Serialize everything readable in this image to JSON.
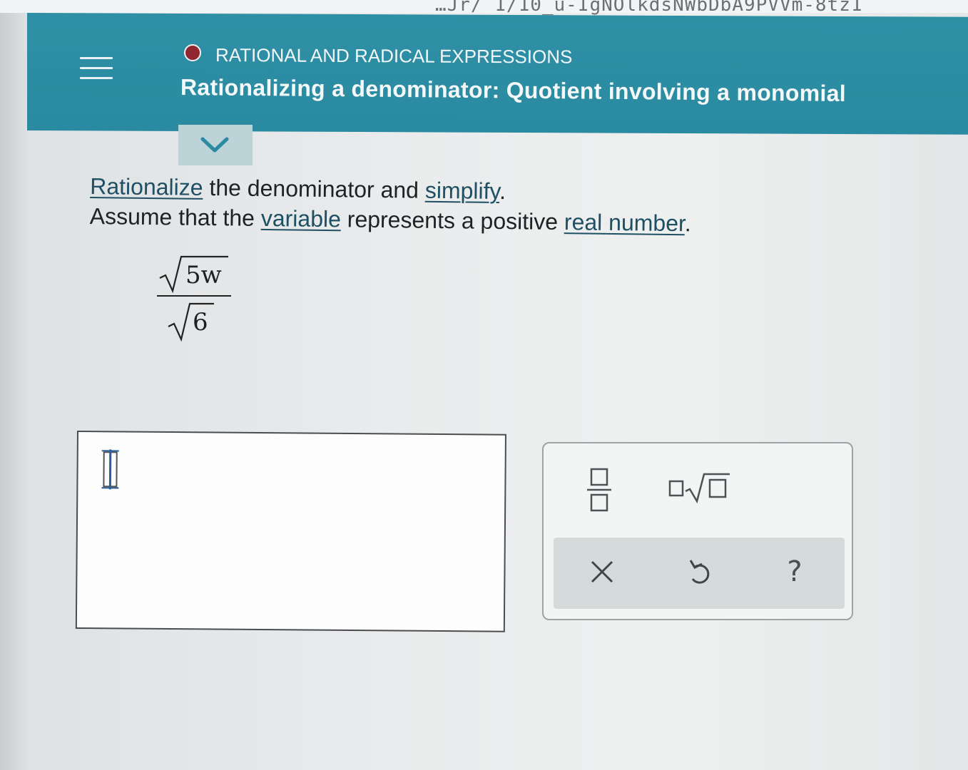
{
  "browser": {
    "url_fragment": "…Jr/ 1/10_u-IgNOlkdsNWbDbA9PVVm-8tz1"
  },
  "header": {
    "topic": "RATIONAL AND RADICAL EXPRESSIONS",
    "title": "Rationalizing a denominator: Quotient involving a monomial",
    "status_color": "#8f2630",
    "accent_color": "#2a8aa1"
  },
  "problem": {
    "link_rationalize": "Rationalize",
    "text_1": " the denominator and ",
    "link_simplify": "simplify",
    "text_2": ".",
    "text_3": "Assume that the ",
    "link_variable": "variable",
    "text_4": " represents a positive ",
    "link_real_number": "real number",
    "text_5": ".",
    "numerator_radicand": "5w",
    "denominator_radicand": "6"
  },
  "keypad": {
    "fraction_key": "fraction-icon",
    "nth_root_key": "nth-root-icon",
    "clear_key": "close-icon",
    "undo_key": "undo-icon",
    "help_key": "?"
  }
}
